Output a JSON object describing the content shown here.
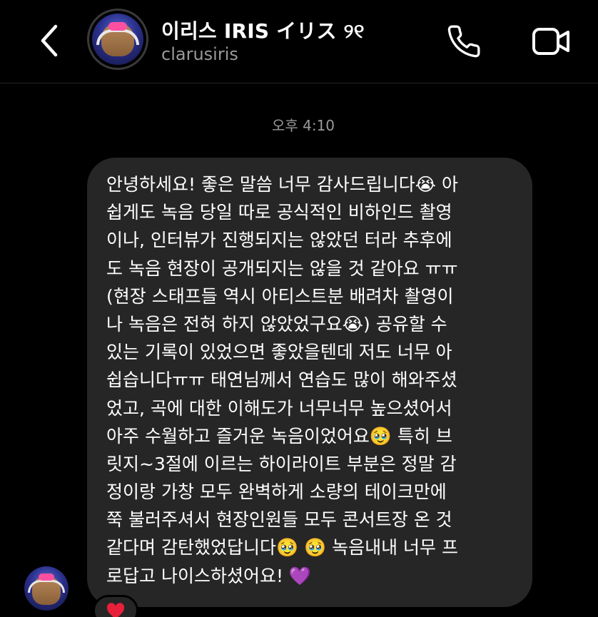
{
  "header": {
    "display_name": "이리스 IRIS イリス ୨୧",
    "username": "clarusiris"
  },
  "thread": {
    "timestamp": "오후 4:10",
    "message_lines": [
      "안녕하세요! 좋은 말씀 너무 감사드립니다😭 아",
      "쉽게도 녹음 당일 따로 공식적인 비하인드 촬영",
      "이나, 인터뷰가 진행되지는 않았던 터라 추후에",
      "도 녹음 현장이 공개되지는 않을 것 같아요 ㅠㅠ",
      "(현장 스태프들 역시 아티스트분 배려차 촬영이",
      "나 녹음은 전혀 하지 않았었구요😭) 공유할 수",
      "있는 기록이 있었으면 좋았을텐데 저도 너무 아",
      "쉽습니다ㅠㅠ 태연님께서 연습도 많이 해와주셨",
      "었고, 곡에 대한 이해도가 너무너무 높으셨어서",
      "아주 수월하고 즐거운 녹음이었어요🥹 특히 브",
      "릿지~3절에 이르는 하이라이트 부분은 정말 감",
      "정이랑 가창 모두 완벽하게 소량의 테이크만에",
      "쭉 불러주셔서 현장인원들 모두 콘서트장 온 것",
      "같다며 감탄했었답니다🥹 🥹  녹음내내 너무 프",
      "로답고 나이스하셨어요! 💜"
    ],
    "reaction": "❤️"
  },
  "icons": {
    "back": "chevron-left-icon",
    "call": "phone-icon",
    "video": "video-camera-icon"
  },
  "colors": {
    "background": "#000000",
    "bubble": "#262626",
    "secondary_text": "#9a9a9a"
  }
}
